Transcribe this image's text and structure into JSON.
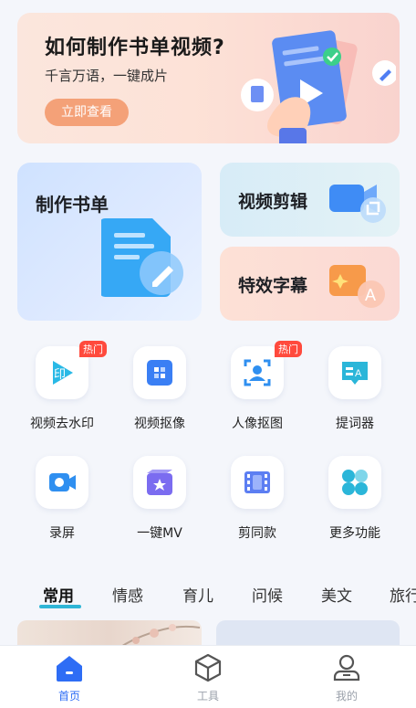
{
  "banner": {
    "title": "如何制作书单视频?",
    "subtitle": "千言万语，一键成片",
    "button": "立即查看"
  },
  "cards": {
    "make_booklist": "制作书单",
    "video_edit": "视频剪辑",
    "effect_subtitle": "特效字幕"
  },
  "tools": [
    {
      "label": "视频去水印",
      "icon": "watermark-remove-icon",
      "badge": "热门"
    },
    {
      "label": "视频抠像",
      "icon": "video-matting-icon",
      "badge": ""
    },
    {
      "label": "人像抠图",
      "icon": "portrait-cutout-icon",
      "badge": "热门"
    },
    {
      "label": "提词器",
      "icon": "teleprompter-icon",
      "badge": ""
    },
    {
      "label": "录屏",
      "icon": "screen-record-icon",
      "badge": ""
    },
    {
      "label": "一键MV",
      "icon": "one-click-mv-icon",
      "badge": ""
    },
    {
      "label": "剪同款",
      "icon": "template-cut-icon",
      "badge": ""
    },
    {
      "label": "更多功能",
      "icon": "more-features-icon",
      "badge": ""
    }
  ],
  "tabs": [
    "常用",
    "情感",
    "育儿",
    "问候",
    "美文",
    "旅行"
  ],
  "active_tab": "常用",
  "nav": [
    {
      "label": "首页",
      "icon": "home-icon",
      "active": true
    },
    {
      "label": "工具",
      "icon": "cube-icon",
      "active": false
    },
    {
      "label": "我的",
      "icon": "profile-icon",
      "active": false
    }
  ],
  "colors": {
    "accent_blue": "#2e6df5",
    "tab_underline": "#2fb5d6",
    "hot_badge": "#ff4a3d",
    "banner_button": "#f4a178"
  }
}
